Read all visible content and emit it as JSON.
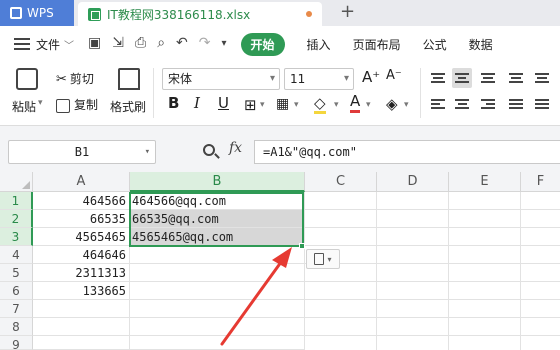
{
  "tabs": {
    "app": "WPS",
    "file": "IT教程网338166118.xlsx",
    "new_tab": "+"
  },
  "menu": {
    "file": "文件",
    "start": "开始",
    "insert": "插入",
    "page_layout": "页面布局",
    "formula": "公式",
    "data": "数据"
  },
  "ribbon": {
    "paste": "粘贴",
    "cut": "剪切",
    "copy": "复制",
    "format_painter": "格式刷",
    "font_name": "宋体",
    "font_size": "11",
    "bold": "B",
    "italic": "I",
    "underline": "U",
    "font_color_letter": "A",
    "grow_font": "A⁺",
    "shrink_font": "A⁻"
  },
  "formula_bar": {
    "name_box": "B1",
    "fx": "fx",
    "formula": "=A1&\"@qq.com\""
  },
  "grid": {
    "columns": [
      "A",
      "B",
      "C",
      "D",
      "E",
      "F"
    ],
    "rows": [
      "1",
      "2",
      "3",
      "4",
      "5",
      "6",
      "7",
      "8",
      "9"
    ],
    "col_a": [
      "464566",
      "66535",
      "4565465",
      "464646",
      "2311313",
      "133665"
    ],
    "col_b": [
      "464566@qq.com",
      "66535@qq.com",
      "4565465@qq.com"
    ]
  },
  "colors": {
    "accent_green": "#2f9a55",
    "arrow_red": "#e63a32",
    "tab_blue": "#4f7ed7"
  }
}
